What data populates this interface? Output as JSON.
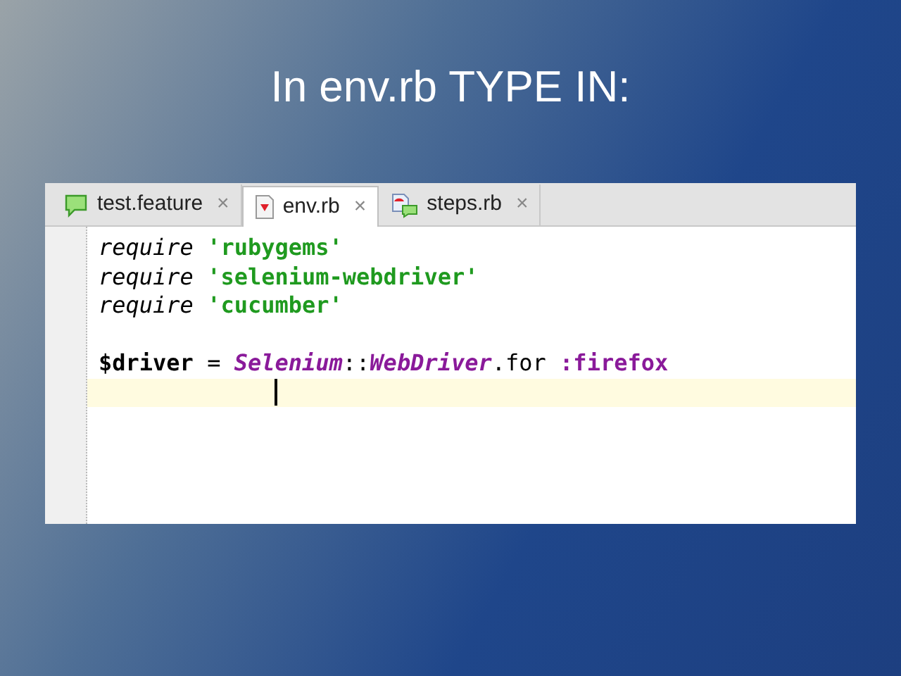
{
  "slide_title": "In env.rb TYPE IN:",
  "tabs": [
    {
      "label": "test.feature",
      "kind": "feature",
      "selected": false,
      "close": "×"
    },
    {
      "label": "env.rb",
      "kind": "ruby",
      "selected": true,
      "close": "×"
    },
    {
      "label": "steps.rb",
      "kind": "steps",
      "selected": false,
      "close": "×"
    }
  ],
  "lines": [
    {
      "current": false,
      "tokens": [
        {
          "kind": "keyword",
          "text": "require "
        },
        {
          "kind": "string",
          "text": "'rubygems'"
        }
      ]
    },
    {
      "current": false,
      "tokens": [
        {
          "kind": "keyword",
          "text": "require "
        },
        {
          "kind": "string",
          "text": "'selenium-webdriver'"
        }
      ]
    },
    {
      "current": false,
      "tokens": [
        {
          "kind": "keyword",
          "text": "require "
        },
        {
          "kind": "string",
          "text": "'cucumber'"
        }
      ]
    },
    {
      "current": false
    },
    {
      "current": false,
      "tokens": [
        {
          "kind": "global",
          "text": "$driver"
        },
        {
          "kind": "plain",
          "text": " = "
        },
        {
          "kind": "constant",
          "text": "Selenium"
        },
        {
          "kind": "plain",
          "text": "::"
        },
        {
          "kind": "constant",
          "text": "WebDriver"
        },
        {
          "kind": "plain",
          "text": ".for "
        },
        {
          "kind": "symbol",
          "text": ":firefox"
        }
      ]
    },
    {
      "current": true
    }
  ]
}
